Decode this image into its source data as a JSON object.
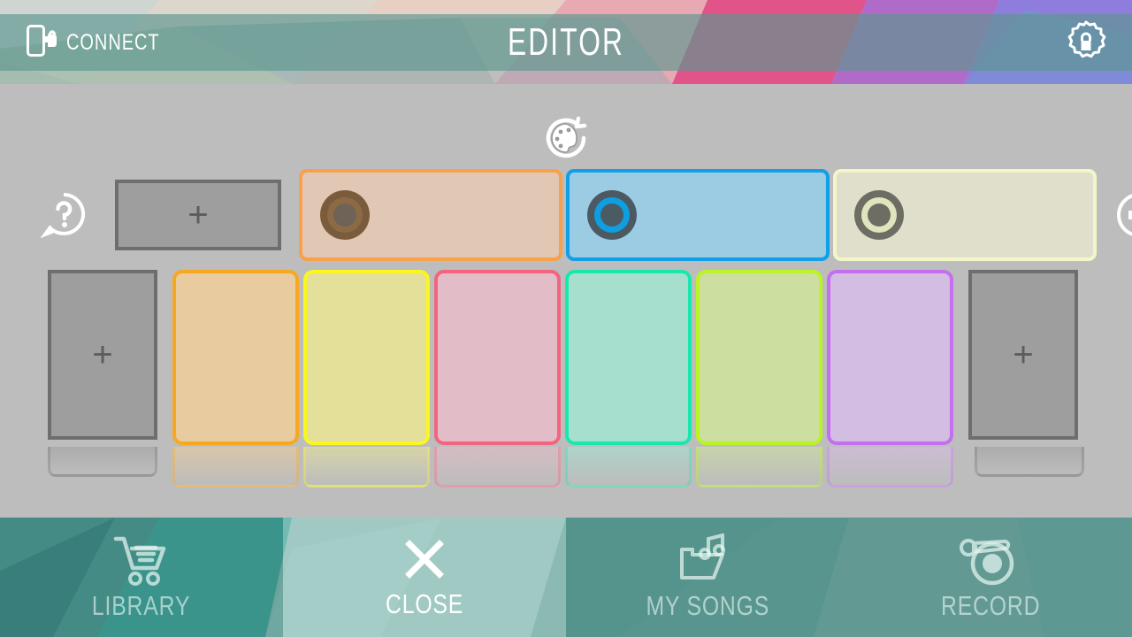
{
  "header": {
    "connect_label": "CONNECT",
    "connect_icon": "phone-plug-icon",
    "title": "EDITOR",
    "settings_icon": "gear-lock-icon"
  },
  "stage": {
    "randomize_icon": "palette-reset-icon",
    "help_icon": "question-bubble-icon",
    "volume_icon": "speaker-icon",
    "add_label": "+",
    "background_color": "#bdbdbd"
  },
  "tracks": [
    {
      "name": "track-1",
      "fill": "#e1c8b4",
      "border": "#f9a04a",
      "knob_outer": "#7a5c3d",
      "knob_mid": "#8c6a45",
      "knob_core": "#6e6356"
    },
    {
      "name": "track-2",
      "fill": "#9ccbe4",
      "border": "#119fe8",
      "knob_outer": "#4b5a62",
      "knob_mid": "#0f9ee0",
      "knob_core": "#4a5b64"
    },
    {
      "name": "track-3",
      "fill": "#dfdfcc",
      "border": "#f3f6c8",
      "knob_outer": "#6d6d63",
      "knob_mid": "#e2e4bf",
      "knob_core": "#6d6d63"
    }
  ],
  "cards": [
    {
      "name": "card-orange",
      "fill": "#e8cb9e",
      "border": "#f7a821"
    },
    {
      "name": "card-yellow",
      "fill": "#e4e09a",
      "border": "#f9f620"
    },
    {
      "name": "card-pink",
      "fill": "#e2bcc6",
      "border": "#f4647f"
    },
    {
      "name": "card-mint",
      "fill": "#a7dfcf",
      "border": "#17e9ad"
    },
    {
      "name": "card-lime",
      "fill": "#ccdfa1",
      "border": "#baf422"
    },
    {
      "name": "card-violet",
      "fill": "#d3bde2",
      "border": "#c濾"
    }
  ],
  "toolbar": [
    {
      "name": "library",
      "label": "LIBRARY",
      "icon": "shopping-cart-icon",
      "state": "dim"
    },
    {
      "name": "close",
      "label": "CLOSE",
      "icon": "close-x-icon",
      "state": "active"
    },
    {
      "name": "my-songs",
      "label": "MY SONGS",
      "icon": "folder-music-icon",
      "state": "dim"
    },
    {
      "name": "record",
      "label": "RECORD",
      "icon": "turntable-icon",
      "state": "dim"
    }
  ]
}
